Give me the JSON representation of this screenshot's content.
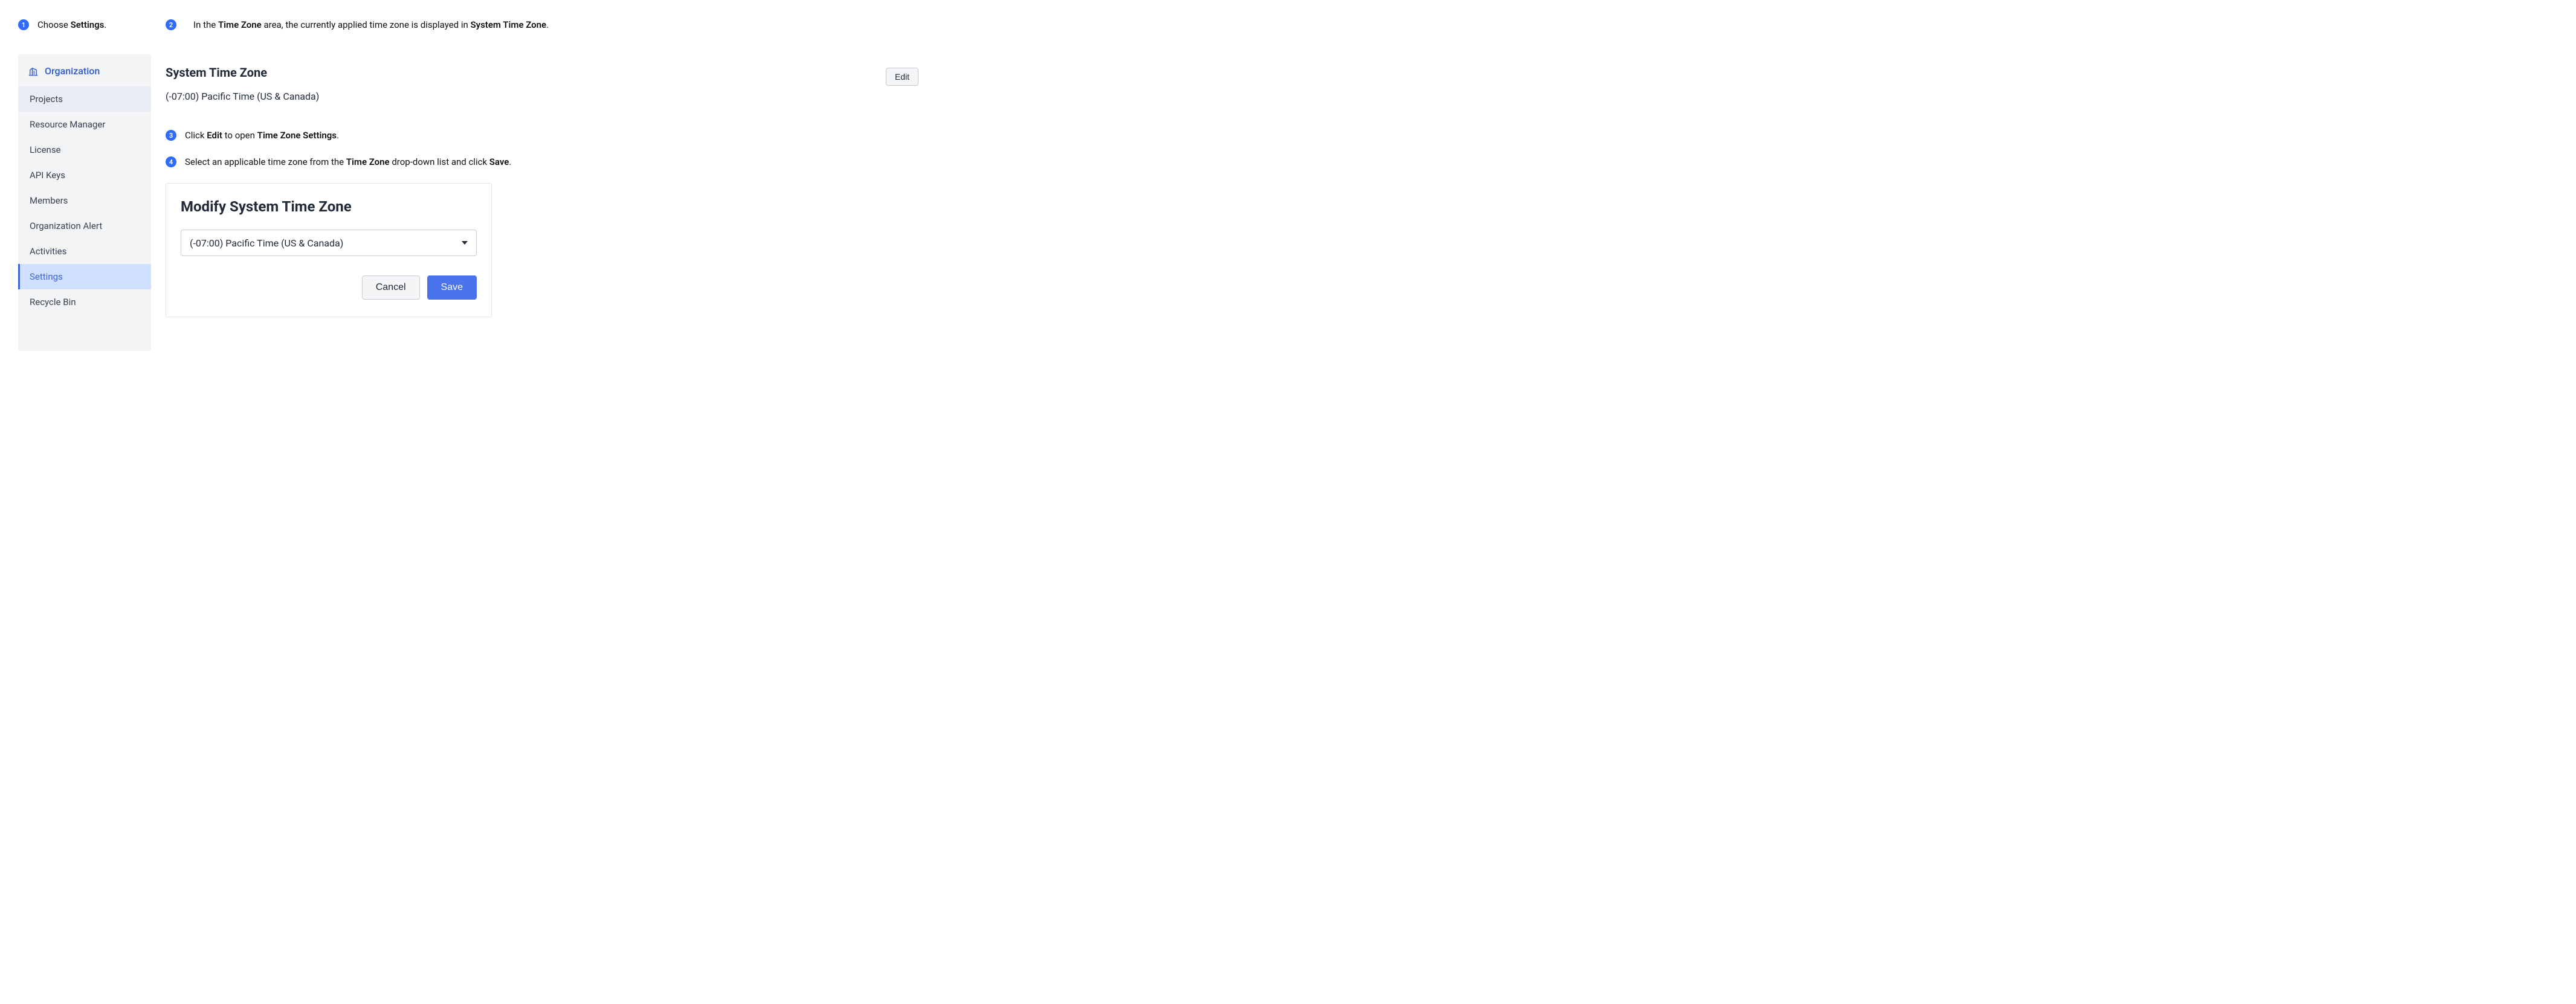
{
  "steps": {
    "s1": {
      "num": "1",
      "prefix": "Choose ",
      "bold1": "Settings",
      "suffix": "."
    },
    "s2": {
      "num": "2",
      "p1": "In the ",
      "b1": "Time Zone",
      "p2": " area, the currently applied time zone is displayed in ",
      "b2": "System Time Zone",
      "p3": "."
    },
    "s3": {
      "num": "3",
      "p1": "Click ",
      "b1": "Edit",
      "p2": " to open ",
      "b2": "Time Zone Settings",
      "p3": "."
    },
    "s4": {
      "num": "4",
      "p1": "Select an applicable time zone from the ",
      "b1": "Time Zone",
      "p2": " drop-down list and click ",
      "b2": "Save",
      "p3": "."
    }
  },
  "sidebar": {
    "header": "Organization",
    "items": [
      {
        "label": "Projects"
      },
      {
        "label": "Resource Manager"
      },
      {
        "label": "License"
      },
      {
        "label": "API Keys"
      },
      {
        "label": "Members"
      },
      {
        "label": "Organization Alert"
      },
      {
        "label": "Activities"
      },
      {
        "label": "Settings"
      },
      {
        "label": "Recycle Bin"
      }
    ]
  },
  "sys_tz": {
    "title": "System Time Zone",
    "value": "(-07:00) Pacific Time (US & Canada)",
    "edit_label": "Edit"
  },
  "modify": {
    "title": "Modify System Time Zone",
    "selected": "(-07:00) Pacific Time (US & Canada)",
    "cancel_label": "Cancel",
    "save_label": "Save"
  }
}
